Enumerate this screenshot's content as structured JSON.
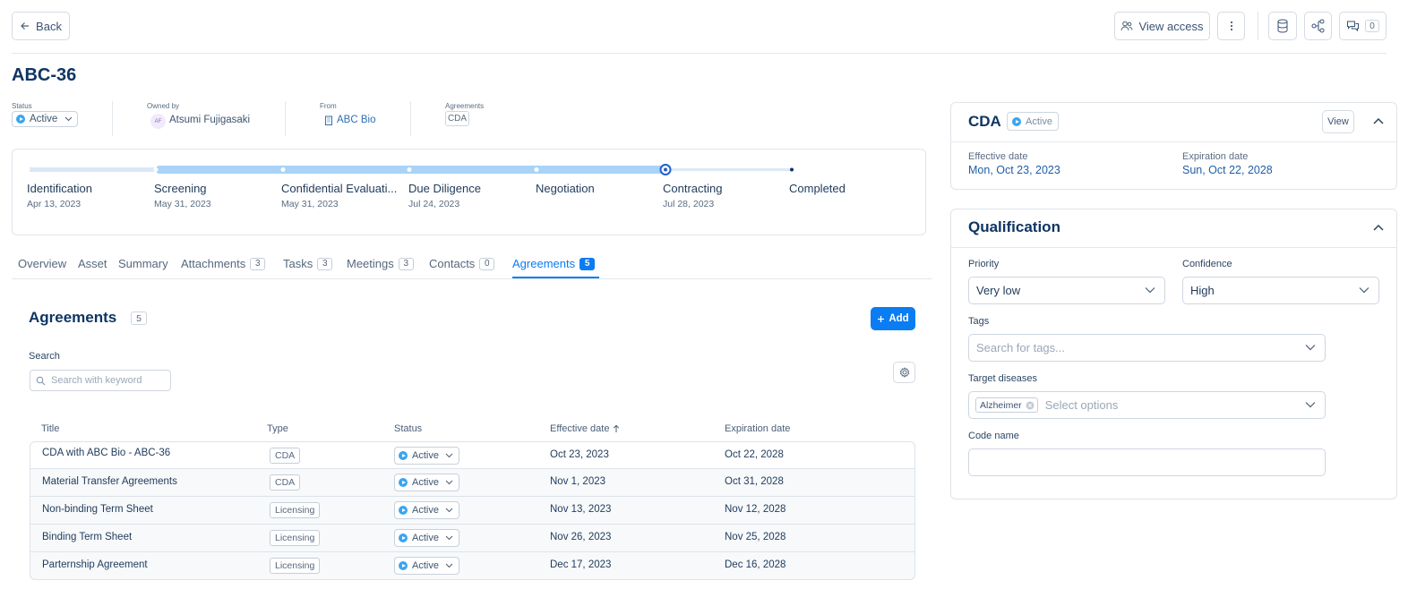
{
  "header": {
    "back_label": "Back",
    "view_access_label": "View access",
    "comments_count": "0"
  },
  "page": {
    "title": "ABC-36"
  },
  "meta": {
    "status_label": "Status",
    "status_value": "Active",
    "owned_by_label": "Owned by",
    "owner_initials": "AF",
    "owner_name": "Atsumi Fujigasaki",
    "from_label": "From",
    "from_value": "ABC Bio",
    "agreements_label": "Agreements",
    "agreements_value": "CDA"
  },
  "pipeline": {
    "current_stage_index": 5,
    "stages": [
      {
        "name": "Identification",
        "date": "Apr 13, 2023"
      },
      {
        "name": "Screening",
        "date": "May 31, 2023"
      },
      {
        "name": "Confidential Evaluati...",
        "date": "May 31, 2023"
      },
      {
        "name": "Due Diligence",
        "date": "Jul 24, 2023"
      },
      {
        "name": "Negotiation",
        "date": ""
      },
      {
        "name": "Contracting",
        "date": "Jul 28, 2023"
      },
      {
        "name": "Completed",
        "date": ""
      }
    ]
  },
  "tabs": [
    {
      "label": "Overview",
      "count": ""
    },
    {
      "label": "Asset",
      "count": ""
    },
    {
      "label": "Summary",
      "count": ""
    },
    {
      "label": "Attachments",
      "count": "3"
    },
    {
      "label": "Tasks",
      "count": "3"
    },
    {
      "label": "Meetings",
      "count": "3"
    },
    {
      "label": "Contacts",
      "count": "0"
    },
    {
      "label": "Agreements",
      "count": "5"
    }
  ],
  "agreements": {
    "heading": "Agreements",
    "count": "5",
    "add_label": "Add",
    "search_label": "Search",
    "search_placeholder": "Search with keyword",
    "columns": {
      "title": "Title",
      "type": "Type",
      "status": "Status",
      "effective": "Effective date",
      "expiration": "Expiration date"
    },
    "rows": [
      {
        "title": "CDA with ABC Bio - ABC-36",
        "type": "CDA",
        "status": "Active",
        "effective": "Oct 23, 2023",
        "expiration": "Oct 22, 2028"
      },
      {
        "title": "Material Transfer Agreements",
        "type": "CDA",
        "status": "Active",
        "effective": "Nov 1, 2023",
        "expiration": "Oct 31, 2028"
      },
      {
        "title": "Non-binding Term Sheet",
        "type": "Licensing",
        "status": "Active",
        "effective": "Nov 13, 2023",
        "expiration": "Nov 12, 2028"
      },
      {
        "title": "Binding Term Sheet",
        "type": "Licensing",
        "status": "Active",
        "effective": "Nov 26, 2023",
        "expiration": "Nov 25, 2028"
      },
      {
        "title": "Parternship Agreement",
        "type": "Licensing",
        "status": "Active",
        "effective": "Dec 17, 2023",
        "expiration": "Dec 16, 2028"
      }
    ]
  },
  "cda_panel": {
    "title": "CDA",
    "status": "Active",
    "view_label": "View",
    "effective_label": "Effective date",
    "effective_value": "Mon, Oct 23, 2023",
    "expiration_label": "Expiration date",
    "expiration_value": "Sun, Oct 22, 2028"
  },
  "qualification": {
    "title": "Qualification",
    "priority_label": "Priority",
    "priority_value": "Very low",
    "confidence_label": "Confidence",
    "confidence_value": "High",
    "tags_label": "Tags",
    "tags_placeholder": "Search for tags...",
    "diseases_label": "Target diseases",
    "disease_tag": "Alzheimer",
    "diseases_placeholder": "Select options",
    "code_name_label": "Code name",
    "code_name_value": ""
  },
  "colors": {
    "primary": "#0b7cf2",
    "navy": "#0f3563",
    "progress_done": "#a9d3f7",
    "active_dot": "#3aa5f0"
  }
}
